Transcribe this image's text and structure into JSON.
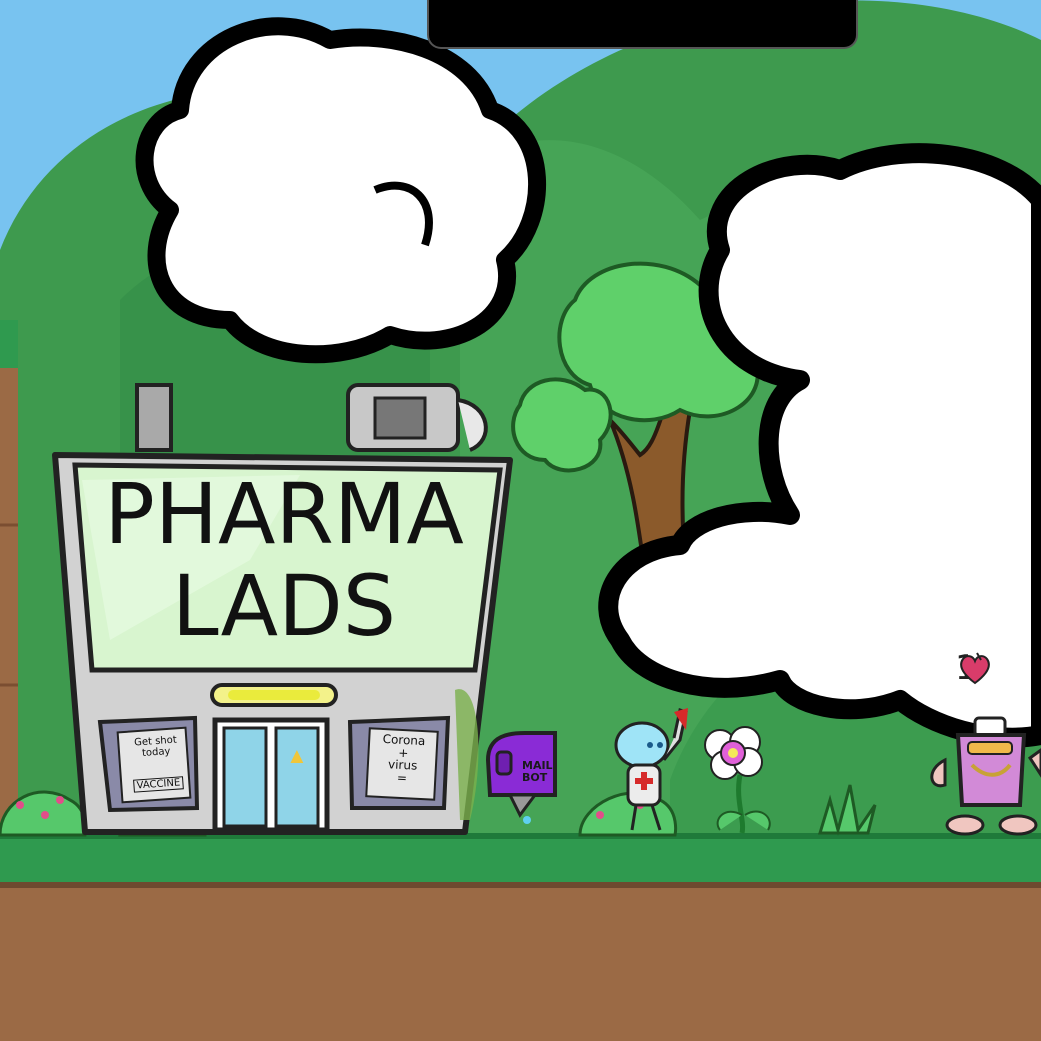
{
  "hud": {
    "top_bar_text": "",
    "health_count": "1"
  },
  "building": {
    "sign_line_1": "PHARMA",
    "sign_line_2": "LADS",
    "left_poster_line_1": "Get shot",
    "left_poster_line_2": "today",
    "left_poster_label": "VACCINE",
    "right_poster_line_1": "Corona",
    "right_poster_line_2": "+",
    "right_poster_line_3": "virus",
    "right_poster_line_4": "="
  },
  "mailbox": {
    "line_1": "MAIL",
    "line_2": "BOT"
  },
  "icons": {
    "health": "heart-icon",
    "door_marker": "warning-triangle-icon"
  },
  "colors": {
    "sky": "#78c3f0",
    "hills": "#3e9a4e",
    "grass": "#2f9a4f",
    "dirt": "#9b6a45",
    "building_glass": "#d8f5cf",
    "mailbox": "#8a2bd6",
    "enemy": "#d28ad7",
    "heart": "#d93c6a"
  }
}
